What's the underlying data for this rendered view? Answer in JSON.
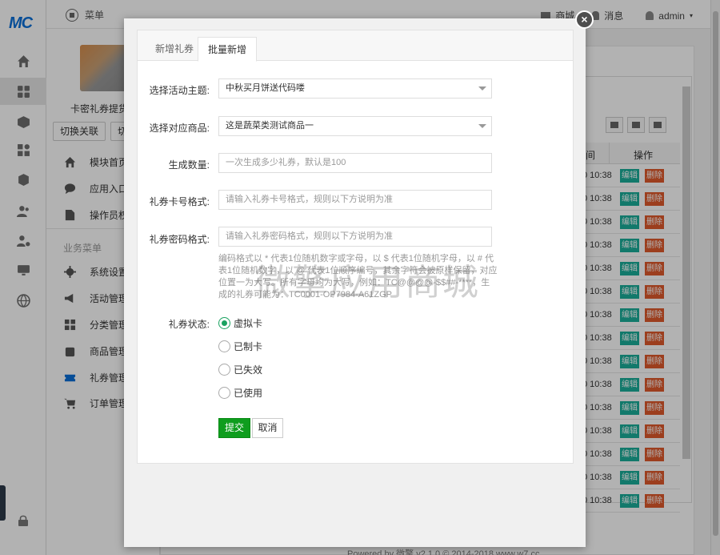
{
  "rail": {
    "logo": "MC"
  },
  "topbar": {
    "menu_label": "菜单",
    "shop_label": "商城",
    "messages_label": "消息",
    "user_label": "admin"
  },
  "app": {
    "name": "卡密礼券提货系统",
    "switch_button": "切换关联",
    "second_button": "切"
  },
  "sidebar": {
    "top_items": [
      {
        "label": "模块首页",
        "icon": "home-icon"
      },
      {
        "label": "应用入口",
        "icon": "chat-icon"
      },
      {
        "label": "操作员权限",
        "icon": "edit-icon"
      }
    ],
    "section_title": "业务菜单",
    "business_items": [
      {
        "label": "系统设置",
        "icon": "gear-icon"
      },
      {
        "label": "活动管理",
        "icon": "megaphone-icon"
      },
      {
        "label": "分类管理",
        "icon": "grid-icon"
      },
      {
        "label": "商品管理",
        "icon": "bag-icon"
      },
      {
        "label": "礼券管理",
        "icon": "ticket-icon"
      },
      {
        "label": "订单管理",
        "icon": "cart-icon"
      }
    ]
  },
  "background_table": {
    "header_time": "间",
    "header_actions": "操作",
    "row_time": "0 10:38",
    "edit_label": "编辑",
    "delete_label": "删除",
    "row_count": 15
  },
  "footer": {
    "text": "Powered by 微擎 v2.1.0 © 2014-2018 www.w7.cc"
  },
  "modal": {
    "tabs": [
      "新增礼券",
      "批量新增"
    ],
    "active_tab": 1,
    "fields": {
      "theme": {
        "label": "选择活动主题:",
        "value": "中秋买月饼送代码喽"
      },
      "product": {
        "label": "选择对应商品:",
        "value": "这是蔬菜类测试商品一"
      },
      "quantity": {
        "label": "生成数量:",
        "placeholder": "一次生成多少礼券，默认是100"
      },
      "card_format": {
        "label": "礼券卡号格式:",
        "placeholder": "请输入礼券卡号格式，规则以下方说明为准"
      },
      "pwd_format": {
        "label": "礼券密码格式:",
        "placeholder": "请输入礼券密码格式，规则以下方说明为准"
      }
    },
    "help_text": "编码格式以 * 代表1位随机数字或字母，以 $ 代表1位随机字母，以 # 代表1位随机数字，以 @ 代表1位顺序编号，其余字符会被原样保留，对应位置一为大写。所有字母均为大写，例如：TC@@@@-$$##-****，生成的礼券可能为：TC0001-OP7984-A61ZGP",
    "status": {
      "label": "礼券状态:",
      "options": [
        "虚拟卡",
        "已制卡",
        "已失效",
        "已使用"
      ],
      "selected": 0
    },
    "submit_label": "提交",
    "cancel_label": "取消",
    "close_symbol": "×"
  },
  "watermark": "微擎应用商城"
}
